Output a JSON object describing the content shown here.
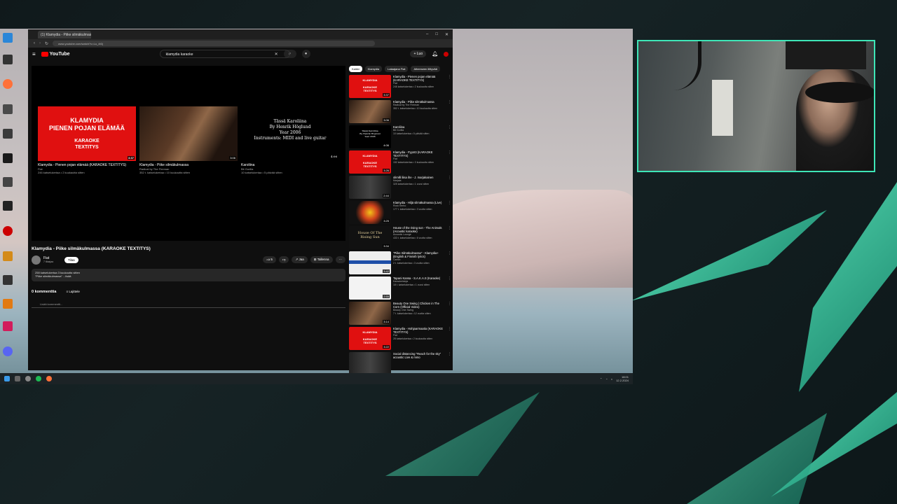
{
  "browser": {
    "tab_title": "(1) Klamydia - Piike silmäkulmassa (KARAOKE TEXTITYS) - YouTube",
    "url": "www.youtube.com/watch?v=Lu_4t0j"
  },
  "youtube": {
    "logo": "YouTube",
    "search_value": "klamydia karaoke",
    "create_label": "+ Luo"
  },
  "end_cards": [
    {
      "title": "Klamydia - Pienen pojan elämää (KARAOKE TEXTITYS)",
      "channel": "Fiat",
      "meta": "246 katselukertaa • 2 kuukautta sitten",
      "duration": "3:37",
      "thumb_text": "KLAMYDIA\nPIENEN POJAN ELÄMÄÄ\n\nKARAOKE\nTEXTITYS"
    },
    {
      "title": "Klamydia - Piike silmäkulmassa",
      "channel": "Radical by The Fireman",
      "meta": "352 t. katselukertaa • 10 kuukautta sitten",
      "duration": "3:06",
      "thumb_text": ""
    },
    {
      "title": "Karoliina",
      "channel": "Bit Gorilla",
      "meta": "10 katselukertaa • 5 päivää sitten",
      "duration": "4:06",
      "thumb_text": "Tässä Karoliina\nBy Henrik Höglund\nYear 2006\nInstruments: MIDI and live guitar"
    }
  ],
  "video": {
    "title": "Klamydia - Piike silmäkulmassa (KARAOKE TEXTITYS)",
    "channel": "Fiat",
    "subscribers": "7 tilaajaa",
    "subscribe_label": "Tilaa",
    "likes": "5",
    "share_label": "Jaa",
    "save_label": "Tallenna",
    "description_line1": "258 katselukertaa  3 kuukautta sitten",
    "description_line2": "\"Piike silmäkulmassa\" ...lisää"
  },
  "comments": {
    "count_label": "0 kommenttia",
    "sort_label": "Lajittele",
    "input_placeholder": "Lisää kommentti..."
  },
  "chips": [
    "Kaikki",
    "Klamydia",
    "Lataajana Fiat",
    "Aiheeseen liittyvää"
  ],
  "related": [
    {
      "title": "Klamydia - Pienen pojan elämää (KARAOKE TEXTITYS)",
      "channel": "Fiat",
      "meta": "246 katselukertaa • 2 kuukautta sitten",
      "duration": "3:37",
      "style": "karaoke"
    },
    {
      "title": "Klamydia - Piike silmäkulmassa",
      "channel": "Radical by The Fireman",
      "meta": "352 t. katselukertaa • 10 kuukautta sitten",
      "duration": "3:06",
      "style": "photo"
    },
    {
      "title": "Karoliina",
      "channel": "Bit Gorilla",
      "meta": "10 katselukertaa • 5 päivää sitten",
      "duration": "4:06",
      "style": "text"
    },
    {
      "title": "Klamydia - Pyyntö (KARAOKE TEXTITYS)",
      "channel": "Fiat",
      "meta": "152 katselukertaa • 3 kuukautta sitten",
      "duration": "3:26",
      "style": "karaoke"
    },
    {
      "title": "olimilli liisa ihe - J. marjakainen",
      "channel": "Marjala",
      "meta": "325 katselukertaa • 1 vuosi sitten",
      "duration": "2:44",
      "style": "dark"
    },
    {
      "title": "Klamydia - Hiljä silmäkulmassa (Live)",
      "channel": "Rock Kerho",
      "meta": "177 t. katselukertaa • 3 vuotta sitten",
      "duration": "3:25",
      "style": "colorful"
    },
    {
      "title": "House of the rising sun - The Animals (Acoustic karaoke)",
      "channel": "Acoustic Lounge",
      "meta": "433 t. katselukertaa • 6 vuotta sitten",
      "duration": "3:34",
      "style": "house"
    },
    {
      "title": "\"Piike Silmäkulmassa\" - Klamydia+ (English & Finnish lyrics)",
      "channel": "Carton",
      "meta": "2 t. katselukertaa • 3 vuotta sitten",
      "duration": "3:42",
      "style": "flag"
    },
    {
      "title": "Tapani Kansa - S.A.K.A.S (Karaoke)",
      "channel": "Karaokeistoja",
      "meta": "18 t. katselukertaa • 1 vuosi sitten",
      "duration": "2:55",
      "style": "white"
    },
    {
      "title": "Beauty One Swing | Chicken in The Corn (Official Video)",
      "channel": "Beauty One Swing",
      "meta": "7 t. katselukertaa • 12 vuotta sitten",
      "duration": "3:14",
      "style": "photo"
    },
    {
      "title": "Klamydia - Hohjaarmaatia (KARAOKE TEXTITYS)",
      "channel": "Fiat",
      "meta": "28 katselukertaa • 2 kuukautta sitten",
      "duration": "3:22",
      "style": "karaoke"
    },
    {
      "title": "Social distancing \"Reach for the sky\" acoustic Live & mmo",
      "channel": "",
      "meta": "",
      "duration": "",
      "style": "dark"
    }
  ],
  "taskbar": {
    "time": "18:01",
    "date": "12.2.2024"
  },
  "colors": {
    "accent_stream": "#3ee6b7",
    "youtube_red": "#ff0000",
    "karaoke_red": "#e01010"
  }
}
